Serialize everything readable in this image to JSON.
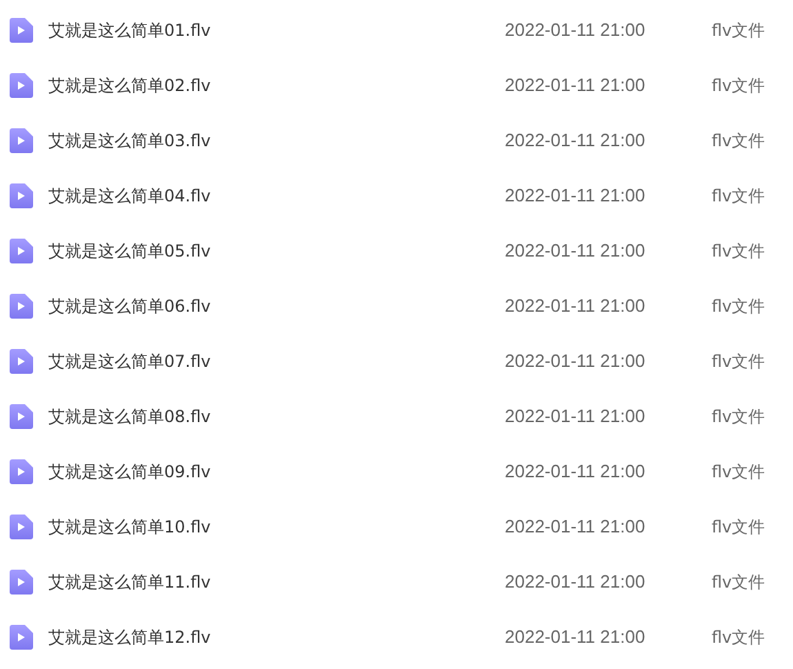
{
  "files": [
    {
      "name": "艾就是这么简单01.flv",
      "modified": "2022-01-11 21:00",
      "type": "flv文件"
    },
    {
      "name": "艾就是这么简单02.flv",
      "modified": "2022-01-11 21:00",
      "type": "flv文件"
    },
    {
      "name": "艾就是这么简单03.flv",
      "modified": "2022-01-11 21:00",
      "type": "flv文件"
    },
    {
      "name": "艾就是这么简单04.flv",
      "modified": "2022-01-11 21:00",
      "type": "flv文件"
    },
    {
      "name": "艾就是这么简单05.flv",
      "modified": "2022-01-11 21:00",
      "type": "flv文件"
    },
    {
      "name": "艾就是这么简单06.flv",
      "modified": "2022-01-11 21:00",
      "type": "flv文件"
    },
    {
      "name": "艾就是这么简单07.flv",
      "modified": "2022-01-11 21:00",
      "type": "flv文件"
    },
    {
      "name": "艾就是这么简单08.flv",
      "modified": "2022-01-11 21:00",
      "type": "flv文件"
    },
    {
      "name": "艾就是这么简单09.flv",
      "modified": "2022-01-11 21:00",
      "type": "flv文件"
    },
    {
      "name": "艾就是这么简单10.flv",
      "modified": "2022-01-11 21:00",
      "type": "flv文件"
    },
    {
      "name": "艾就是这么简单11.flv",
      "modified": "2022-01-11 21:00",
      "type": "flv文件"
    },
    {
      "name": "艾就是这么简单12.flv",
      "modified": "2022-01-11 21:00",
      "type": "flv文件"
    }
  ]
}
